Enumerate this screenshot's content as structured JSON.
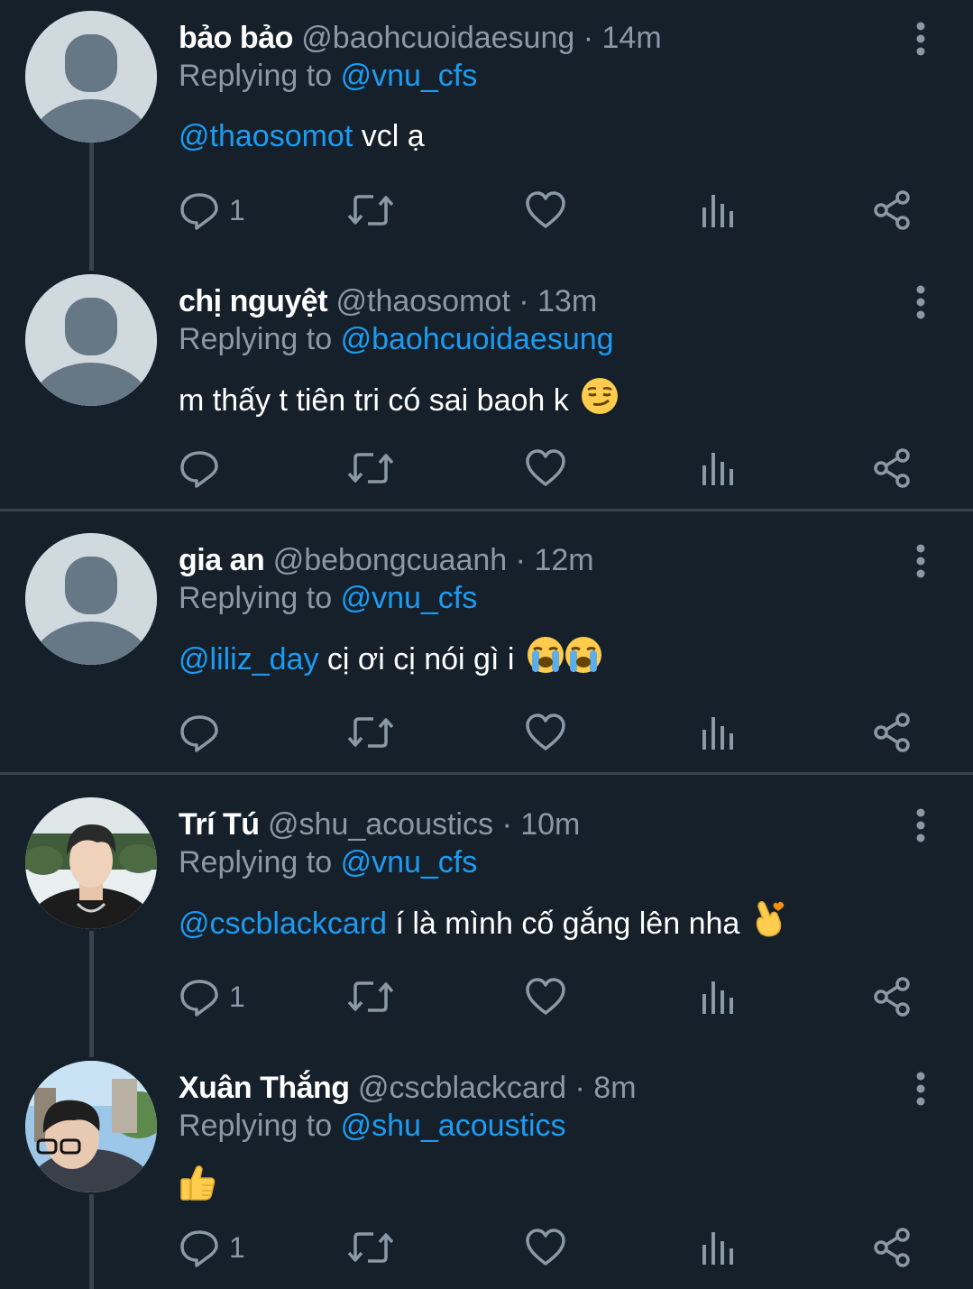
{
  "colors": {
    "background": "#15202b",
    "muted": "#8b98a5",
    "link": "#1d9bf0",
    "divider": "#38444d"
  },
  "labels": {
    "replying_to": "Replying to"
  },
  "tweets": [
    {
      "name": "bảo bảo",
      "handle": "@baohcuoidaesung",
      "time": "14m",
      "replying_to": "@vnu_cfs",
      "mention": "@thaosomot",
      "text": " vcl ạ",
      "emoji": [],
      "reply_count": "1",
      "avatar": "default"
    },
    {
      "name": "chị nguyệt",
      "handle": "@thaosomot",
      "time": "13m",
      "replying_to": "@baohcuoidaesung",
      "mention": "",
      "text": "m thấy t tiên tri có sai baoh k",
      "emoji": [
        "smirking-face-emoji"
      ],
      "reply_count": "",
      "avatar": "default"
    },
    {
      "name": "gia an",
      "handle": "@bebongcuaanh",
      "time": "12m",
      "replying_to": "@vnu_cfs",
      "mention": "@liliz_day",
      "text": " cị ơi cị nói gì i",
      "emoji": [
        "loudly-crying-face-emoji",
        "loudly-crying-face-emoji"
      ],
      "reply_count": "",
      "avatar": "default"
    },
    {
      "name": "Trí Tú",
      "handle": "@shu_acoustics",
      "time": "10m",
      "replying_to": "@vnu_cfs",
      "mention": "@cscblackcard",
      "text": " í là mình cố gắng lên nha",
      "emoji": [
        "finger-heart-emoji"
      ],
      "reply_count": "1",
      "avatar": "photo"
    },
    {
      "name": "Xuân Thắng",
      "handle": "@cscblackcard",
      "time": "8m",
      "replying_to": "@shu_acoustics",
      "mention": "",
      "text": "",
      "emoji": [
        "thumbs-up-emoji"
      ],
      "reply_count": "1",
      "avatar": "photo"
    }
  ]
}
